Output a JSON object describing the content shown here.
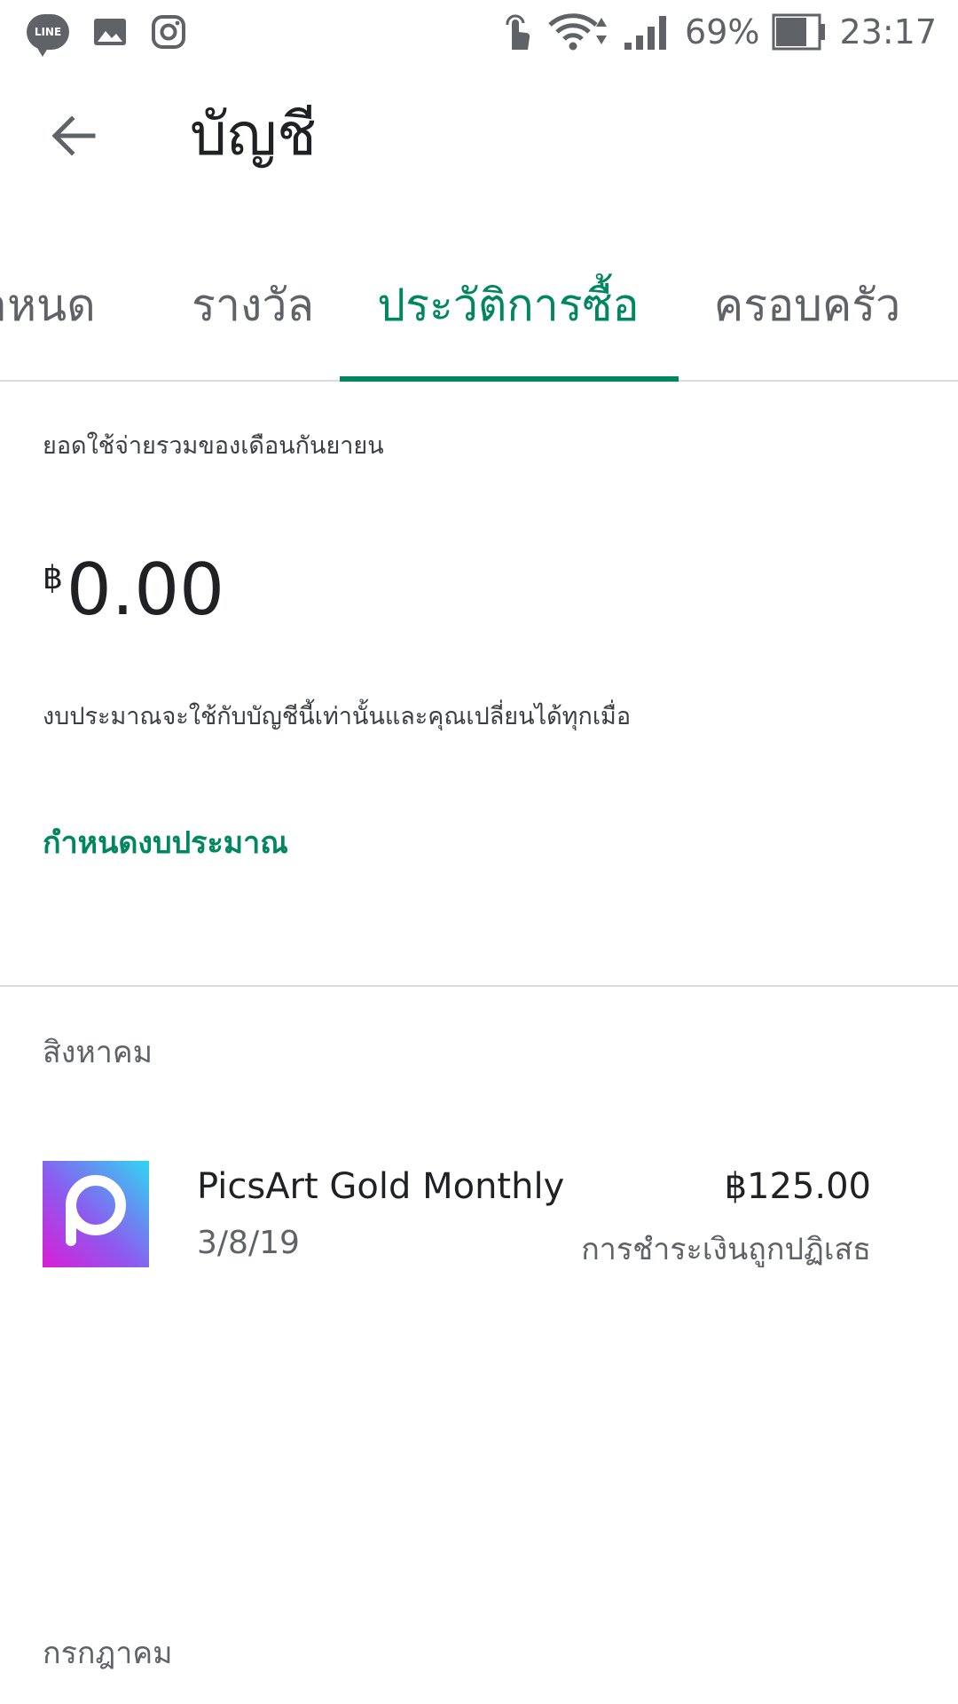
{
  "status_bar": {
    "left_icons": [
      "line-icon",
      "gallery-icon",
      "instagram-icon"
    ],
    "line_badge_text": "LINE",
    "battery_percent": "69%",
    "time": "23:17"
  },
  "app_bar": {
    "title": "บัญชี",
    "back_icon": "arrow-back-icon"
  },
  "tabs": [
    {
      "label": "าหนด",
      "active": false
    },
    {
      "label": "รางวัล",
      "active": false
    },
    {
      "label": "ประวัติการซื้อ",
      "active": true
    },
    {
      "label": "ครอบครัว",
      "active": false
    }
  ],
  "budget": {
    "label": "ยอดใช้จ่ายรวมของเดือนกันยายน",
    "currency": "฿",
    "amount": "0.00",
    "description": "งบประมาณจะใช้กับบัญชีนี้เท่านั้นและคุณเปลี่ยนได้ทุกเมื่อ",
    "set_budget_link": "กำหนดงบประมาณ"
  },
  "history": {
    "months": [
      {
        "name": "สิงหาคม",
        "items": [
          {
            "title": "PicsArt Gold Monthly",
            "date": "3/8/19",
            "price": "฿125.00",
            "status": "การชำระเงินถูกปฏิเสธ"
          }
        ]
      },
      {
        "name": "กรกฎาคม",
        "items": []
      }
    ]
  },
  "colors": {
    "accent": "#01875f",
    "text_primary": "#202124",
    "text_secondary": "#5f6368",
    "divider": "#dadce0"
  }
}
